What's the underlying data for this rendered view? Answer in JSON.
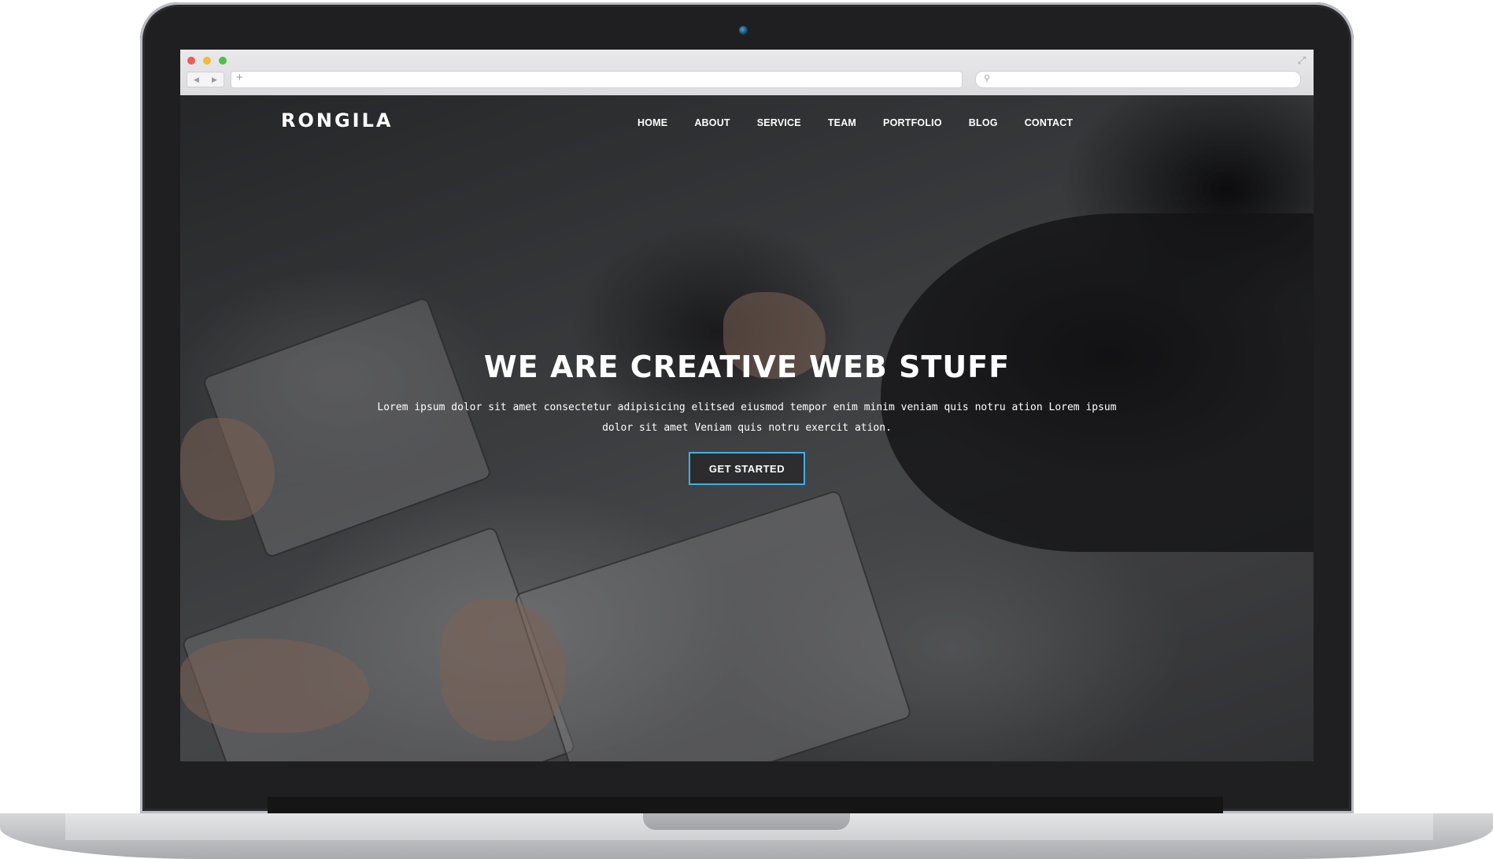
{
  "browser": {
    "url": "",
    "search_placeholder": "",
    "new_tab_symbol": "+",
    "search_icon": "search-icon",
    "expand_icon": "expand-icon"
  },
  "site": {
    "logo": "RONGILA",
    "nav": [
      "HOME",
      "ABOUT",
      "SERVICE",
      "TEAM",
      "PORTFOLIO",
      "BLOG",
      "CONTACT"
    ],
    "hero": {
      "title": "WE ARE CREATIVE WEB STUFF",
      "text": "Lorem ipsum dolor sit amet consectetur adipisicing elitsed eiusmod tempor enim minim veniam quis notru ation Lorem ipsum dolor sit amet Veniam quis notru exercit ation.",
      "cta": "GET STARTED"
    }
  },
  "colors": {
    "accent": "#3fb1e6",
    "text": "#ffffff",
    "bezel": "#1f1f21"
  }
}
